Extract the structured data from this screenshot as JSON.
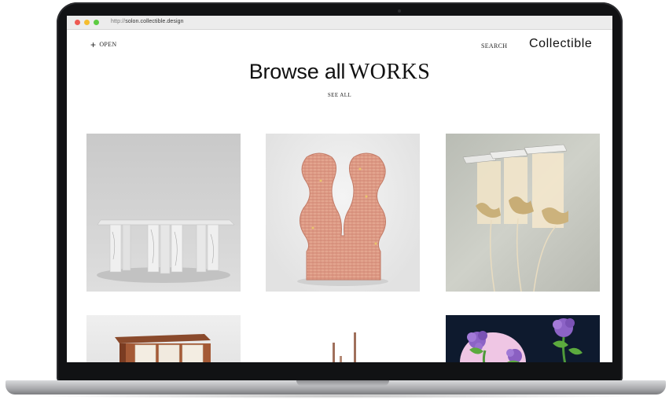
{
  "browser": {
    "url_scheme": "http://",
    "url_host": "solon.collectible.design"
  },
  "header": {
    "open_label": "OPEN",
    "search_label": "SEARCH",
    "brand": "Collectible"
  },
  "hero": {
    "title_part1": "Browse all",
    "title_part2": "WORKS",
    "see_all_label": "SEE ALL"
  },
  "icons": {
    "open": "plus-icon"
  },
  "colors": {
    "close_dot": "#ee5a52",
    "minimize_dot": "#f5bd2f",
    "maximize_dot": "#5ccb42",
    "text": "#111111"
  }
}
